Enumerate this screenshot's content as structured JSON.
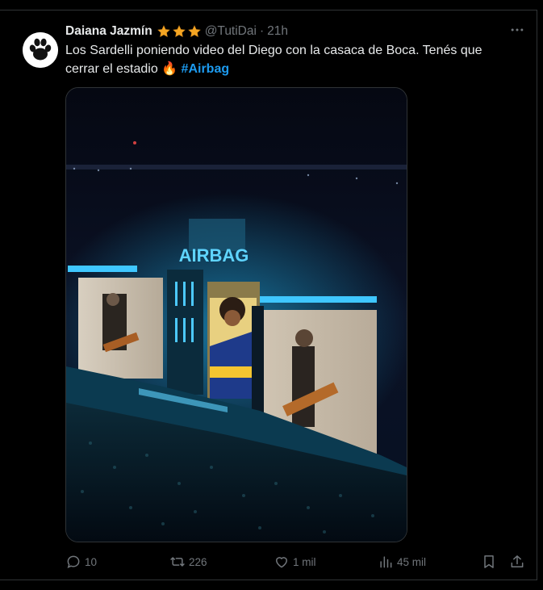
{
  "author": {
    "name": "Daiana Jazmín",
    "handle": "@TutiDai",
    "separator": "·",
    "time": "21h",
    "badge_icons": [
      "star-icon",
      "star-icon",
      "star-icon"
    ],
    "badge_color": "#f5a623"
  },
  "tweet": {
    "text": "Los Sardelli poniendo video del Diego con la casaca de Boca. Tenés que cerrar el estadio 🔥",
    "hashtag": "#Airbag"
  },
  "media": {
    "stage_sign": "AIRBAG"
  },
  "actions": {
    "replies": "10",
    "reposts": "226",
    "likes": "1 mil",
    "views": "45 mil"
  },
  "colors": {
    "background": "#000000",
    "text": "#e7e9ea",
    "muted": "#71767b",
    "link": "#1d9bf0",
    "border": "#2f3336"
  }
}
